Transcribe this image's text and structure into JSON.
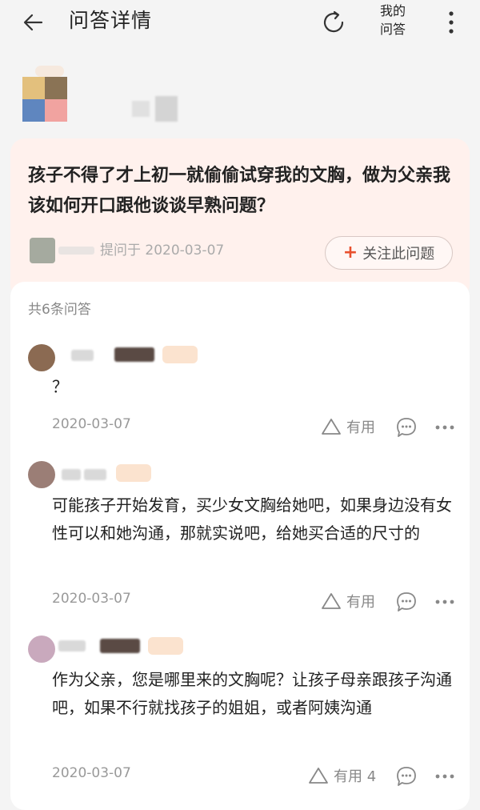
{
  "header": {
    "title": "问答详情",
    "my_answers_line1": "我的",
    "my_answers_line2": "问答"
  },
  "question": {
    "text": "孩子不得了才上初一就偷偷试穿我的文胸，做为父亲我该如何开口跟他谈谈早熟问题？",
    "asked_on": "提问于 2020-03-07",
    "follow_label": "关注此问题",
    "follow_icon": "+"
  },
  "answers_section": {
    "count_label": "共6条问答",
    "items": [
      {
        "text": "？",
        "date": "2020-03-07",
        "useful_label": "有用"
      },
      {
        "text": "可能孩子开始发育，买少女文胸给她吧，如果身边没有女性可以和她沟通，那就实说吧，给她买合适的尺寸的",
        "date": "2020-03-07",
        "useful_label": "有用"
      },
      {
        "text": "作为父亲，您是哪里来的文胸呢？让孩子母亲跟孩子沟通吧，如果不行就找孩子的姐姐，或者阿姨沟通",
        "date": "2020-03-07",
        "useful_label": "有用 4"
      }
    ]
  },
  "colors": {
    "accent": "#e8502e",
    "question_bg": "#fff1ed",
    "page_bg": "#f4f4f4"
  },
  "icons": [
    "back-arrow-icon",
    "refresh-icon",
    "more-vertical-icon",
    "plus-icon",
    "thumb-up-icon",
    "comment-icon",
    "more-horizontal-icon"
  ]
}
